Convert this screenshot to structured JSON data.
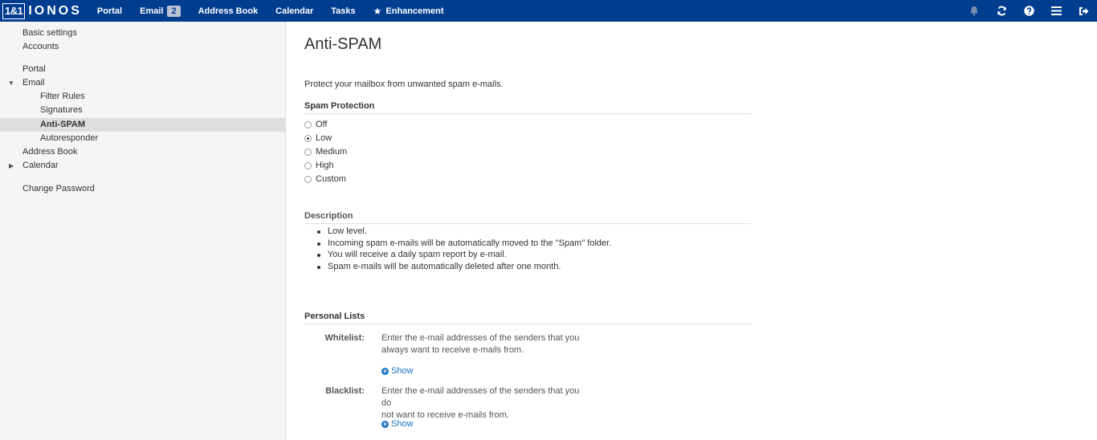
{
  "topbar": {
    "logo_box": "1&1",
    "logo_text": "IONOS",
    "nav": [
      {
        "label": "Portal"
      },
      {
        "label": "Email",
        "badge": "2"
      },
      {
        "label": "Address Book"
      },
      {
        "label": "Calendar"
      },
      {
        "label": "Tasks"
      },
      {
        "label": "Enhancement"
      }
    ],
    "icons": [
      "bell-icon",
      "refresh-icon",
      "help-icon",
      "menu-icon",
      "logout-icon"
    ]
  },
  "sidebar": {
    "items": [
      {
        "label": "Basic settings"
      },
      {
        "label": "Accounts"
      },
      {
        "label": "Portal"
      },
      {
        "label": "Email"
      },
      {
        "label": "Filter Rules"
      },
      {
        "label": "Signatures"
      },
      {
        "label": "Anti-SPAM"
      },
      {
        "label": "Autoresponder"
      },
      {
        "label": "Address Book"
      },
      {
        "label": "Calendar"
      },
      {
        "label": "Change Password"
      }
    ]
  },
  "main": {
    "title": "Anti-SPAM",
    "intro": "Protect your mailbox from unwanted spam e-mails.",
    "spam_protection": {
      "heading": "Spam Protection",
      "options": [
        "Off",
        "Low",
        "Medium",
        "High",
        "Custom"
      ],
      "selected": "Low"
    },
    "description": {
      "heading": "Description",
      "items": [
        "Low level.",
        "Incoming spam e-mails will be automatically moved to the \"Spam\" folder.",
        "You will receive a daily spam report by e-mail.",
        "Spam e-mails will be automatically deleted after one month."
      ]
    },
    "personal_lists": {
      "heading": "Personal Lists",
      "whitelist": {
        "label": "Whitelist:",
        "line1": "Enter the e-mail addresses of the senders that you",
        "line2": "always want to receive e-mails from.",
        "show": "Show"
      },
      "blacklist": {
        "label": "Blacklist:",
        "line1": "Enter the e-mail addresses of the senders that you do",
        "line2": "not want to receive e-mails from.",
        "show": "Show"
      }
    }
  },
  "colors": {
    "topbar": "#003d8f",
    "link": "#1a73c2",
    "sidebar_bg": "#f5f5f5",
    "sidebar_active": "#dedede"
  }
}
